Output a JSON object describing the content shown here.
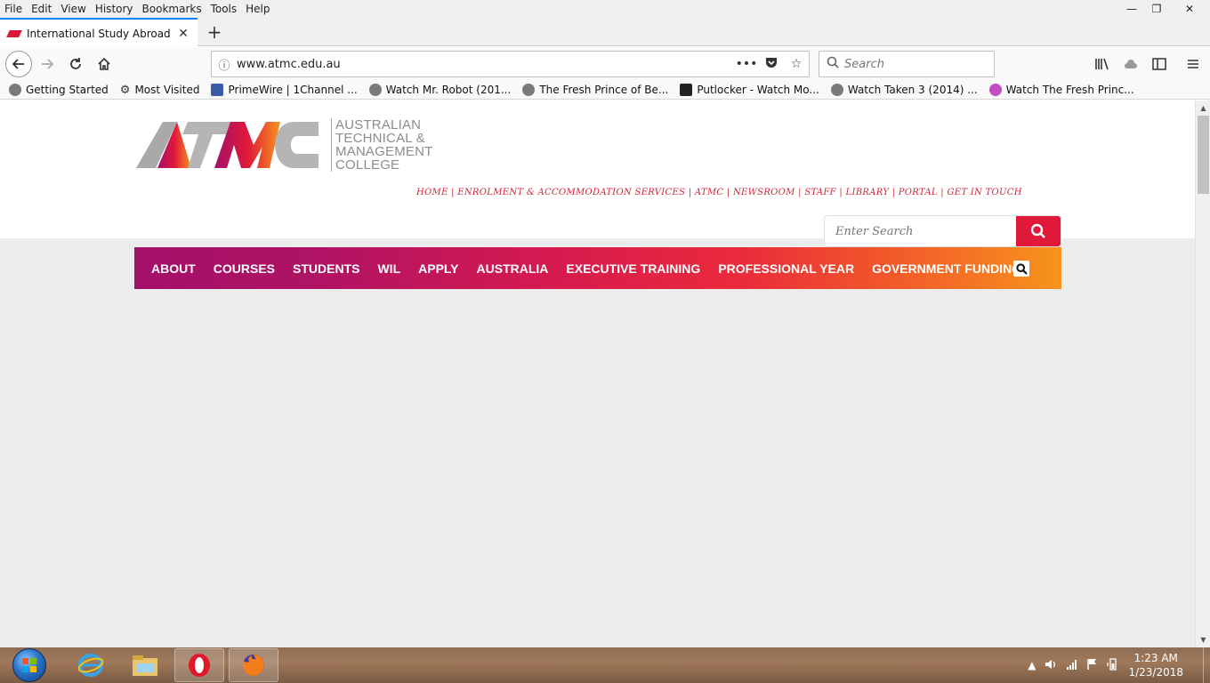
{
  "menubar": {
    "items": [
      "File",
      "Edit",
      "View",
      "History",
      "Bookmarks",
      "Tools",
      "Help"
    ]
  },
  "window": {
    "minimize": "—",
    "restore": "❐",
    "close": "✕"
  },
  "tab": {
    "title": "International Study Abroad Aus",
    "close": "✕",
    "new": "+"
  },
  "nav": {
    "url": "www.atmc.edu.au",
    "search_placeholder": "Search",
    "page_actions": "•••"
  },
  "bookmarks": [
    {
      "label": "Getting Started",
      "icon": "globe-icon"
    },
    {
      "label": "Most Visited",
      "icon": "gear-icon"
    },
    {
      "label": "PrimeWire | 1Channel ...",
      "icon": "film-icon"
    },
    {
      "label": "Watch Mr. Robot (201...",
      "icon": "globe-icon"
    },
    {
      "label": "The Fresh Prince of Be...",
      "icon": "globe-icon"
    },
    {
      "label": "Putlocker - Watch Mo...",
      "icon": "dots-icon"
    },
    {
      "label": "Watch Taken 3 (2014) ...",
      "icon": "globe-icon"
    },
    {
      "label": "Watch The Fresh Princ...",
      "icon": "play-icon"
    }
  ],
  "site": {
    "logo_text_1": "AUSTRALIAN",
    "logo_text_2": "TECHNICAL &",
    "logo_text_3": "MANAGEMENT",
    "logo_text_4": "COLLEGE",
    "toplinks": "HOME | ENROLMENT & ACCOMMODATION SERVICES | ATMC | NEWSROOM | STAFF | LIBRARY | PORTAL | GET IN TOUCH",
    "search_placeholder": "Enter Search",
    "nav_links": [
      "ABOUT",
      "COURSES",
      "STUDENTS",
      "WIL",
      "APPLY",
      "AUSTRALIA",
      "EXECUTIVE TRAINING",
      "PROFESSIONAL YEAR",
      "GOVERNMENT FUNDING"
    ],
    "brand_colors": {
      "primary": "#a3106a",
      "red": "#e0183a",
      "orange": "#f7941d"
    }
  },
  "taskbar": {
    "apps": [
      "start-orb",
      "internet-explorer",
      "file-explorer",
      "opera",
      "firefox"
    ],
    "time": "1:23 AM",
    "date": "1/23/2018"
  }
}
